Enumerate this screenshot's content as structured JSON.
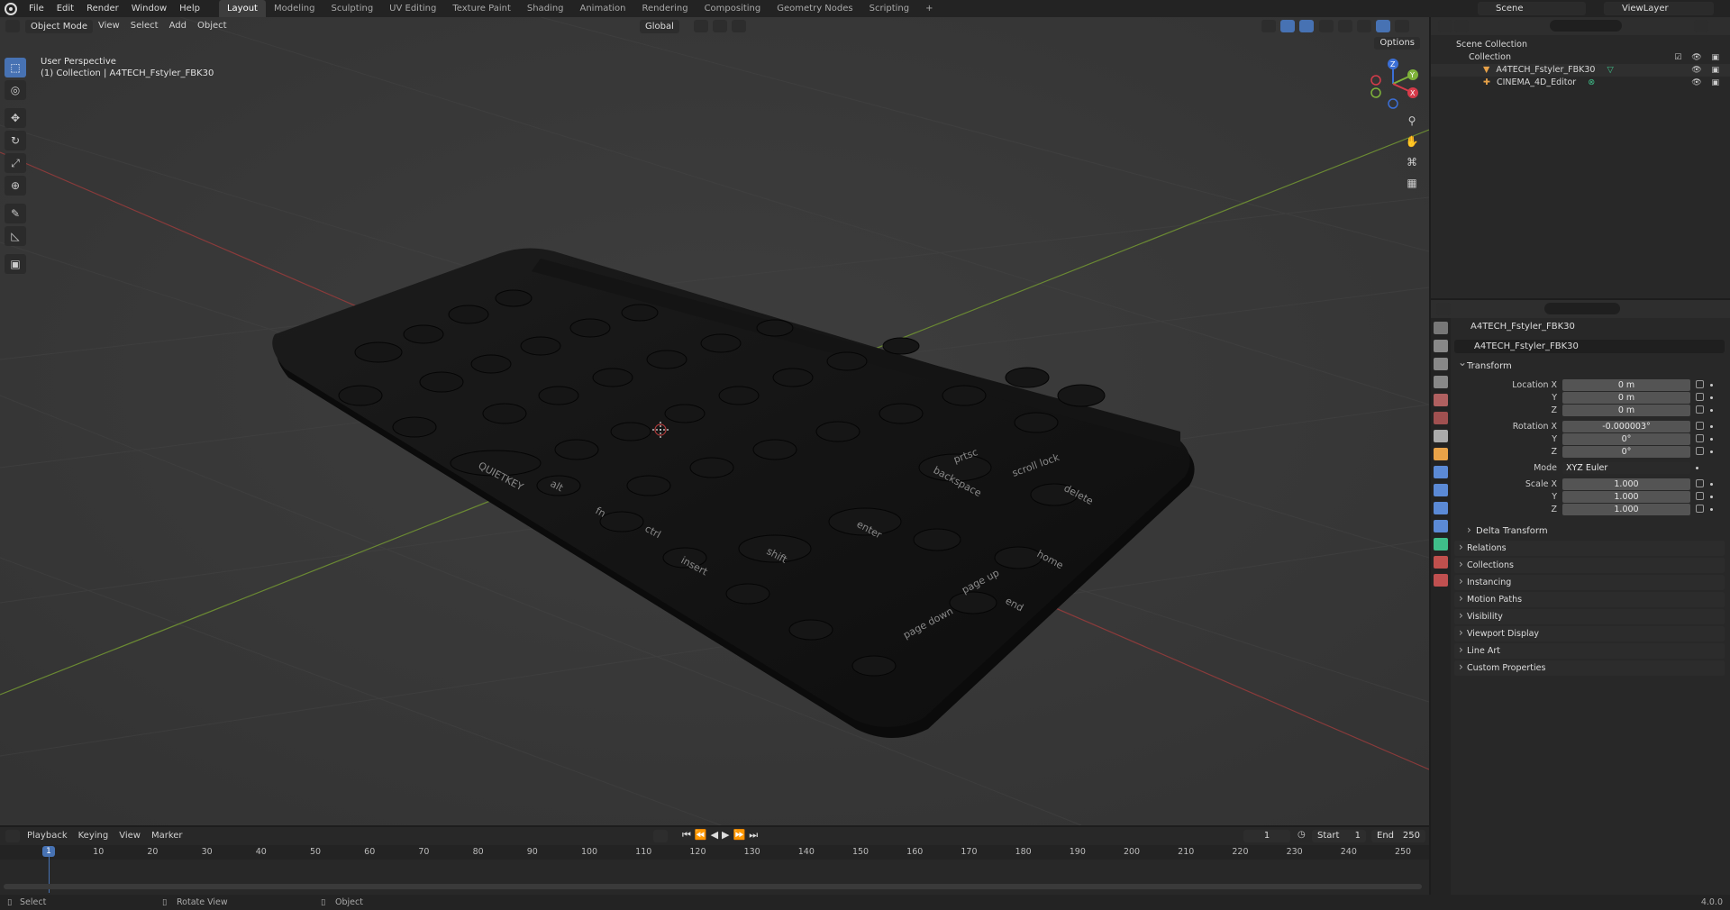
{
  "menu": {
    "items": [
      "File",
      "Edit",
      "Render",
      "Window",
      "Help"
    ],
    "workspaces": [
      "Layout",
      "Modeling",
      "Sculpting",
      "UV Editing",
      "Texture Paint",
      "Shading",
      "Animation",
      "Rendering",
      "Compositing",
      "Geometry Nodes",
      "Scripting"
    ],
    "active_workspace": "Layout",
    "scene": "Scene",
    "view_layer": "ViewLayer"
  },
  "viewport": {
    "mode": "Object Mode",
    "header_menus": [
      "View",
      "Select",
      "Add",
      "Object"
    ],
    "transform_orientation": "Global",
    "options_label": "Options",
    "overlay_line1": "User Perspective",
    "overlay_line2": "(1) Collection | A4TECH_Fstyler_FBK30",
    "gizmo_axes": {
      "x": "X",
      "y": "Y",
      "z": "Z"
    }
  },
  "keyboard_legends": {
    "brand": "QUIETKEY",
    "keys": [
      "backspace",
      "delete",
      "home",
      "end",
      "enter",
      "shift",
      "ctrl",
      "alt",
      "fn",
      "insert",
      "page up",
      "page down",
      "prtsc",
      "scroll lock"
    ]
  },
  "outliner": {
    "root": "Scene Collection",
    "collection": "Collection",
    "objects": [
      "A4TECH_Fstyler_FBK30",
      "CINEMA_4D_Editor"
    ]
  },
  "properties": {
    "object_name": "A4TECH_Fstyler_FBK30",
    "name_field": "A4TECH_Fstyler_FBK30",
    "transform_label": "Transform",
    "location_label": "Location X",
    "location": [
      "0 m",
      "0 m",
      "0 m"
    ],
    "rotation_label": "Rotation X",
    "rotation": [
      "-0.000003°",
      "0°",
      "0°"
    ],
    "mode_label": "Mode",
    "mode_value": "XYZ Euler",
    "scale_label": "Scale X",
    "scale": [
      "1.000",
      "1.000",
      "1.000"
    ],
    "axis_y": "Y",
    "axis_z": "Z",
    "delta_transform": "Delta Transform",
    "panels": [
      "Relations",
      "Collections",
      "Instancing",
      "Motion Paths",
      "Visibility",
      "Viewport Display",
      "Line Art",
      "Custom Properties"
    ]
  },
  "timeline": {
    "menus": [
      "Playback",
      "Keying",
      "View",
      "Marker"
    ],
    "current_frame": "1",
    "start_label": "Start",
    "start": "1",
    "end_label": "End",
    "end": "250",
    "frames": [
      "10",
      "20",
      "30",
      "40",
      "50",
      "60",
      "70",
      "80",
      "90",
      "100",
      "110",
      "120",
      "130",
      "140",
      "150",
      "160",
      "170",
      "180",
      "190",
      "200",
      "210",
      "220",
      "230",
      "240",
      "250"
    ]
  },
  "statusbar": {
    "select": "Select",
    "rotate": "Rotate View",
    "object": "Object",
    "version": "4.0.0"
  }
}
